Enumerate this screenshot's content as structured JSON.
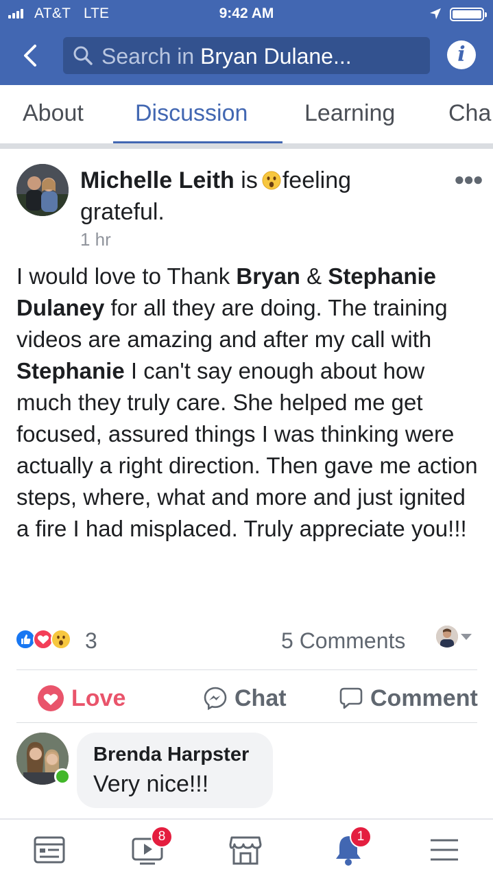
{
  "status_bar": {
    "carrier": "AT&T",
    "network": "LTE",
    "time": "9:42 AM"
  },
  "header": {
    "search_placeholder": "Search in",
    "search_query": "Bryan Dulane...",
    "colors": {
      "brand": "#4267b2",
      "search_bg": "#33528f"
    }
  },
  "tabs": [
    {
      "label": "About",
      "active": false
    },
    {
      "label": "Discussion",
      "active": true
    },
    {
      "label": "Learning",
      "active": false
    },
    {
      "label": "Cha",
      "active": false
    }
  ],
  "post": {
    "author": "Michelle Leith",
    "verb": "is",
    "feeling": "feeling grateful.",
    "feeling_icon": "wow-face-emoji",
    "timestamp": "1 hr",
    "body": {
      "t1": "I would love to Thank ",
      "m1": "Bryan",
      "t2": " & ",
      "m2": "Stephanie Dulaney",
      "t3": " for all they are doing. The training videos are amazing and after my call with ",
      "m3": "Stephanie",
      "t4": " I can't say enough about how much they truly care. She helped me get focused, assured things I was thinking were actually a right direction. Then gave me action steps, where, what and more and just ignited a fire I had misplaced. Truly appreciate you!!!"
    },
    "reactions": {
      "types": [
        "like",
        "love",
        "wow"
      ],
      "count": "3"
    },
    "comments_count": "5 Comments",
    "actions": {
      "love": "Love",
      "chat": "Chat",
      "comment": "Comment"
    },
    "colors": {
      "love": "#e9546b",
      "like": "#1877f2"
    }
  },
  "comment": {
    "author": "Brenda Harpster",
    "text": "Very nice!!!"
  },
  "bottom_nav": {
    "items": [
      "news-feed",
      "watch",
      "marketplace",
      "notifications",
      "menu"
    ],
    "watch_badge": "8",
    "notifications_badge": "1"
  }
}
